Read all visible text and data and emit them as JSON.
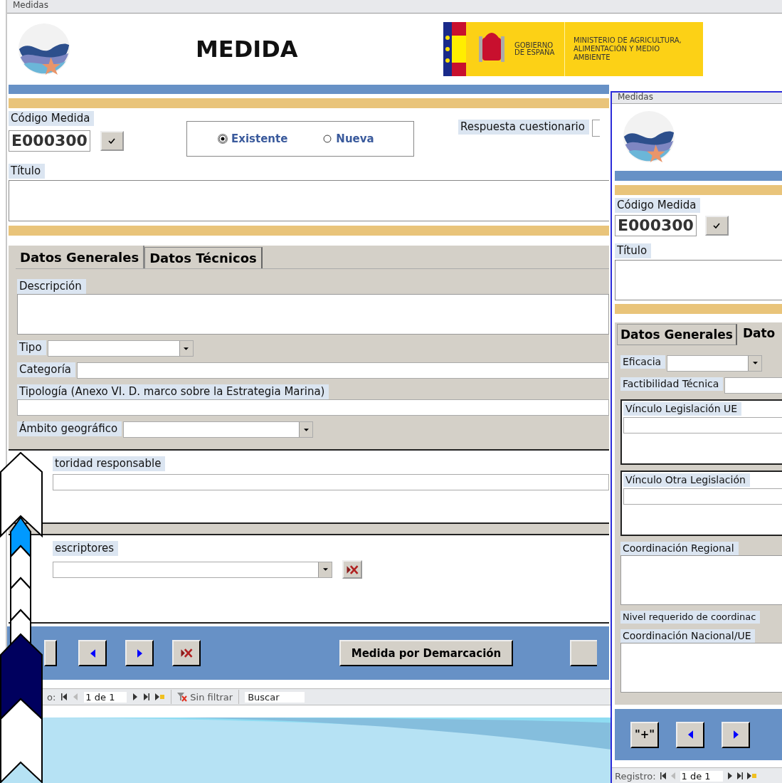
{
  "back_window": {
    "title": "Medidas",
    "heading": "MEDIDA",
    "gov_logo": {
      "government": "GOBIERNO DE ESPAÑA",
      "ministry": "MINISTERIO DE AGRICULTURA, ALIMENTACIÓN Y MEDIO AMBIENTE"
    },
    "code": {
      "label": "Código Medida",
      "value": "E000300"
    },
    "mode_options": [
      {
        "label": "Existente",
        "selected": true
      },
      {
        "label": "Nueva",
        "selected": false
      }
    ],
    "questionnaire_label": "Respuesta cuestionario",
    "title_label": "Título",
    "tabs": [
      {
        "label": "Datos Generales",
        "selected": true
      },
      {
        "label": "Datos Técnicos",
        "selected": false
      }
    ],
    "fields": [
      {
        "label": "Descripción",
        "kind": "memo"
      },
      {
        "label": "Tipo",
        "kind": "combo"
      },
      {
        "label": "Categoría",
        "kind": "text"
      },
      {
        "label": "Tipología (Anexo VI. D. marco sobre la Estrategia Marina)",
        "kind": "line"
      },
      {
        "label": "Ámbito geográfico",
        "kind": "combo-wide"
      }
    ],
    "subforms": [
      {
        "label": "toridad responsable",
        "kind": "line"
      },
      {
        "label": "escriptores",
        "kind": "combo-delete"
      }
    ],
    "buttons": [
      {
        "kind": "stub"
      },
      {
        "kind": "prev"
      },
      {
        "kind": "next"
      },
      {
        "kind": "delete"
      },
      {
        "kind": "text",
        "label": "Medida por Demarcación"
      },
      {
        "kind": "stub"
      }
    ],
    "record_nav": {
      "label": "o:",
      "position": "1 de 1",
      "filter": "Sin filtrar",
      "search": "Buscar"
    }
  },
  "front_window": {
    "title": "Medidas",
    "code": {
      "label": "Código Medida",
      "value": "E000300"
    },
    "title_label": "Título",
    "tabs": [
      {
        "label": "Datos Generales",
        "selected": false
      },
      {
        "label": "Dato",
        "selected": true
      }
    ],
    "fields": [
      {
        "label": "Eficacia",
        "kind": "combo"
      },
      {
        "label": "Factibilidad Técnica",
        "kind": "text"
      },
      {
        "label": "Vínculo Legislación UE",
        "kind": "group"
      },
      {
        "label": "Vínculo Otra Legislación",
        "kind": "group"
      },
      {
        "label": "Coordinación Regional",
        "kind": "memo"
      },
      {
        "label": "Nivel requerido de coordinac",
        "kind": "label"
      },
      {
        "label": "Coordinación Nacional/UE",
        "kind": "memo"
      }
    ],
    "buttons": [
      {
        "kind": "add",
        "label": "\"+\""
      },
      {
        "kind": "prev"
      },
      {
        "kind": "next"
      }
    ],
    "record_nav": {
      "label": "Registro:",
      "position": "1 de 1"
    }
  }
}
